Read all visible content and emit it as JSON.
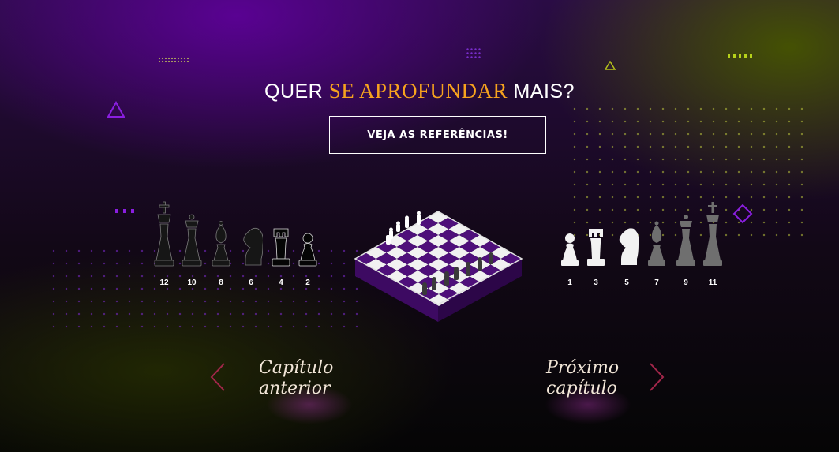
{
  "header": {
    "title_prefix": "QUER ",
    "title_accent": "SE APROFUNDAR",
    "title_suffix": " MAIS?",
    "button_label": "VEJA AS REFERÊNCIAS!"
  },
  "pieces_left": {
    "labels": [
      "12",
      "10",
      "8",
      "6",
      "4",
      "2"
    ],
    "icons": [
      "king-icon",
      "queen-icon",
      "bishop-icon",
      "knight-icon",
      "rook-icon",
      "pawn-icon"
    ]
  },
  "pieces_right": {
    "labels": [
      "1",
      "3",
      "5",
      "7",
      "9",
      "11"
    ],
    "icons": [
      "pawn-icon",
      "rook-icon",
      "knight-icon",
      "bishop-icon",
      "queen-icon",
      "king-icon"
    ]
  },
  "nav": {
    "previous_line1": "Capítulo",
    "previous_line2": "anterior",
    "next_line1": "Próximo",
    "next_line2": "capítulo"
  },
  "colors": {
    "accent": "#f7a31e",
    "purple": "#4e0f7a",
    "arrow": "#a3264a"
  }
}
